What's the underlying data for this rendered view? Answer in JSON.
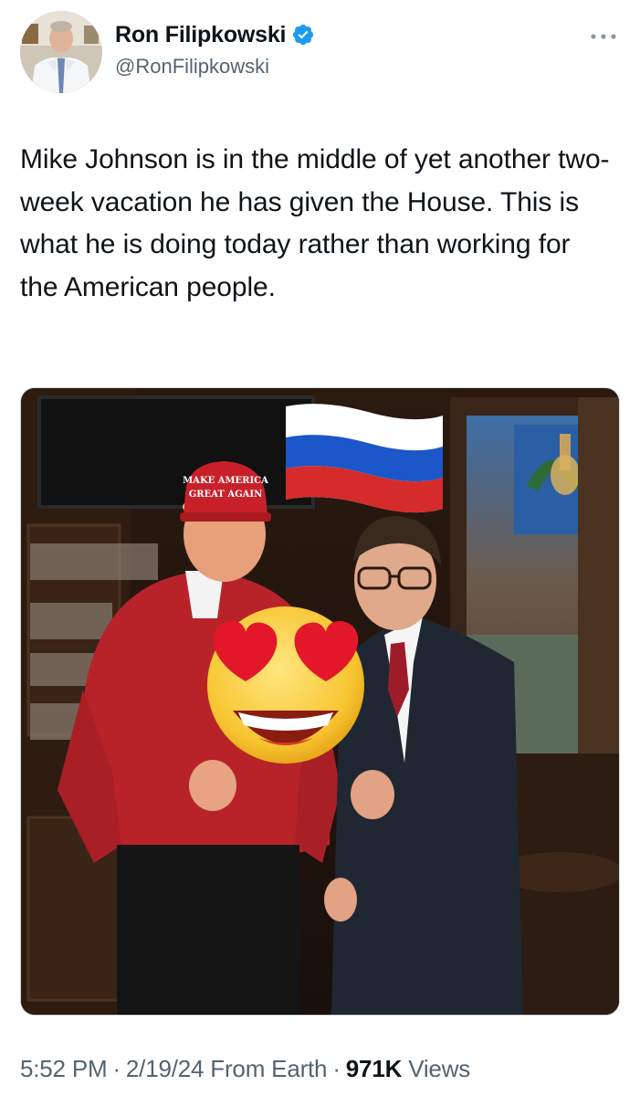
{
  "author": {
    "display_name": "Ron Filipkowski",
    "handle": "@RonFilipkowski",
    "verified": true,
    "verified_color": "#1d9bf0"
  },
  "tweet": {
    "text": "Mike Johnson is in the middle of yet another two-week vacation he has given the House. This is what he is doing today rather than working for the American people."
  },
  "media": {
    "photo_elements": {
      "hat_text_line1": "MAKE AMERICA",
      "hat_text_line2": "GREAT AGAIN",
      "emoji_face": "smiling-face-with-heart-eyes",
      "emoji_flag": "flag-russia"
    }
  },
  "meta": {
    "time": "5:52 PM",
    "date": "2/19/24",
    "source": "From Earth",
    "separator": "·",
    "views_count": "971K",
    "views_label": "Views"
  },
  "icons": {
    "more": "more-options-icon",
    "verified": "verified-badge-icon"
  }
}
